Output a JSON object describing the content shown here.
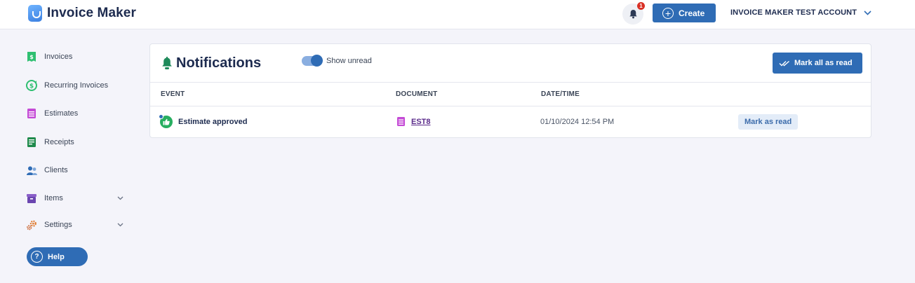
{
  "app": {
    "name": "Invoice Maker"
  },
  "header": {
    "notification_count": "1",
    "create_label": "Create",
    "account_label": "INVOICE MAKER TEST ACCOUNT"
  },
  "sidebar": {
    "items": [
      {
        "label": "Invoices",
        "icon": "invoice-icon"
      },
      {
        "label": "Recurring Invoices",
        "icon": "recurring-icon"
      },
      {
        "label": "Estimates",
        "icon": "estimate-icon"
      },
      {
        "label": "Receipts",
        "icon": "receipt-icon"
      },
      {
        "label": "Clients",
        "icon": "clients-icon"
      },
      {
        "label": "Items",
        "icon": "items-icon"
      },
      {
        "label": "Settings",
        "icon": "settings-icon"
      }
    ],
    "help_label": "Help"
  },
  "notifications": {
    "title": "Notifications",
    "toggle_label": "Show unread",
    "toggle_on": true,
    "mark_all_label": "Mark all as read",
    "columns": [
      "EVENT",
      "DOCUMENT",
      "DATE/TIME"
    ],
    "rows": [
      {
        "event": "Estimate approved",
        "document": "EST8",
        "datetime": "01/10/2024 12:54 PM",
        "action": "Mark as read"
      }
    ]
  },
  "colors": {
    "primary": "#2f6cb5",
    "background": "#f4f4fa",
    "badge": "#d93025",
    "success": "#27ae60",
    "bell_green": "#1e8a5a"
  }
}
